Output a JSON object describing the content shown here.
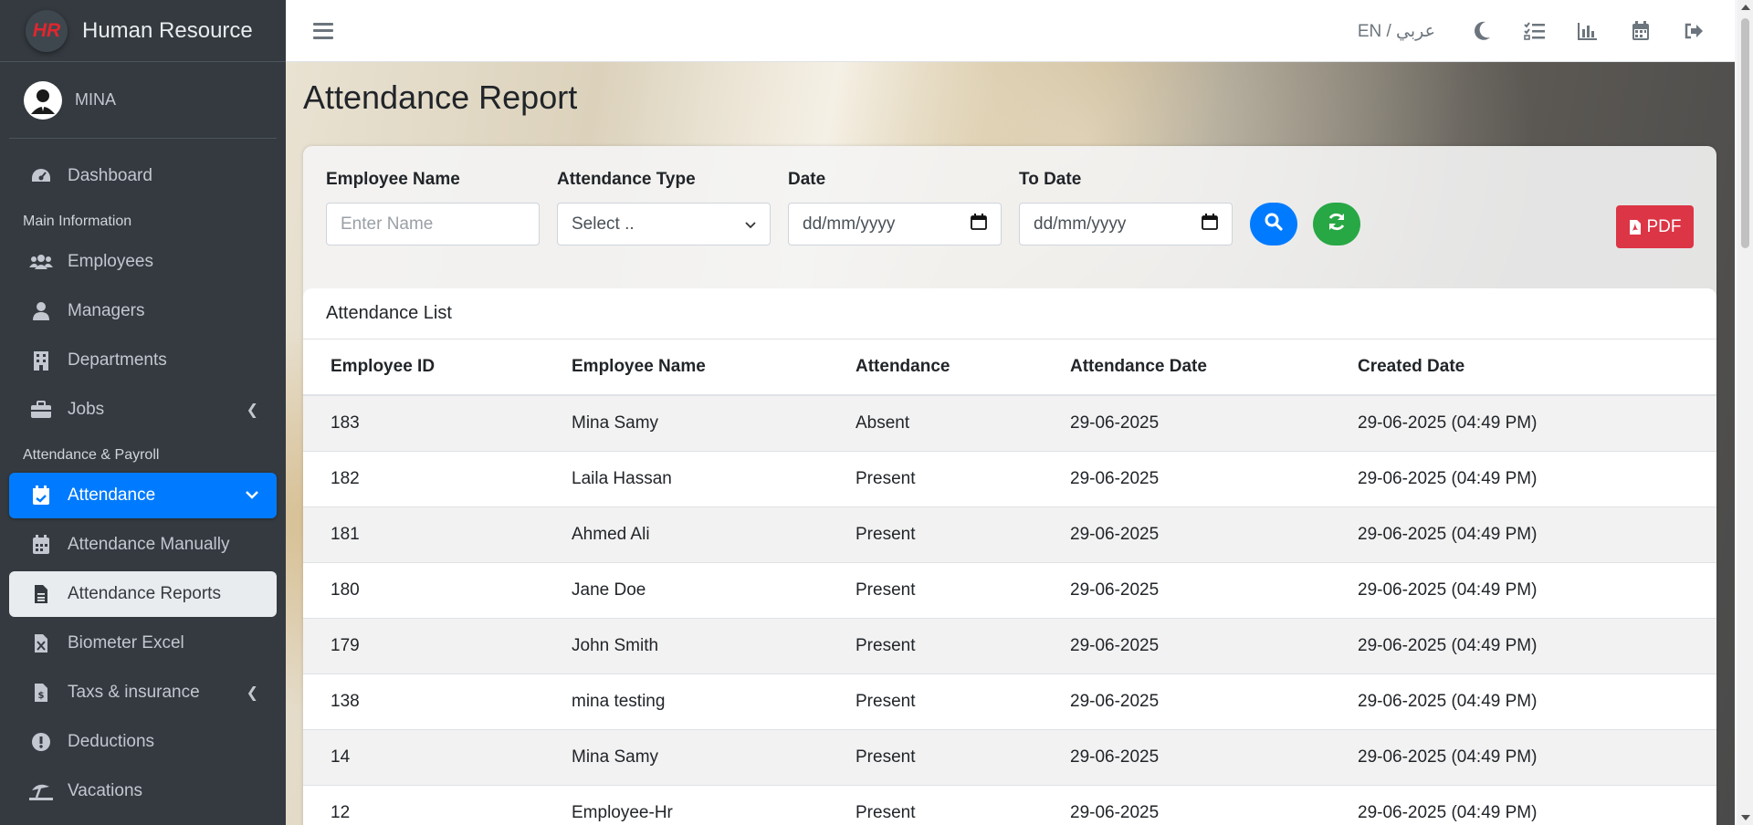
{
  "brand": {
    "name": "Human Resource",
    "logo_text": "HR"
  },
  "user": {
    "name": "MINA"
  },
  "sidebar": {
    "items": [
      {
        "label": "Dashboard",
        "icon": "tachometer-icon"
      },
      {
        "header": "Main Information"
      },
      {
        "label": "Employees",
        "icon": "users-icon"
      },
      {
        "label": "Managers",
        "icon": "user-icon"
      },
      {
        "label": "Departments",
        "icon": "building-icon"
      },
      {
        "label": "Jobs",
        "icon": "briefcase-icon"
      },
      {
        "header": "Attendance & Payroll"
      },
      {
        "label": "Attendance",
        "icon": "calendar-check-icon"
      },
      {
        "label": "Attendance Manually",
        "icon": "calendar-icon"
      },
      {
        "label": "Attendance Reports",
        "icon": "file-alt-icon"
      },
      {
        "label": "Biometer Excel",
        "icon": "file-excel-icon"
      },
      {
        "label": "Taxs & insurance",
        "icon": "file-invoice-dollar-icon"
      },
      {
        "label": "Deductions",
        "icon": "exclamation-circle-icon"
      },
      {
        "label": "Vacations",
        "icon": "umbrella-beach-icon"
      }
    ]
  },
  "topbar": {
    "language": "EN / عربي"
  },
  "page": {
    "title": "Attendance Report"
  },
  "filters": {
    "employee_name_label": "Employee Name",
    "employee_name_placeholder": "Enter Name",
    "attendance_type_label": "Attendance Type",
    "attendance_type_value": "Select ..",
    "date_label": "Date",
    "date_value": "dd/mm/yyyy",
    "to_date_label": "To Date",
    "to_date_value": "dd/mm/yyyy",
    "pdf_label": "PDF"
  },
  "list": {
    "title": "Attendance List",
    "columns": [
      "Employee ID",
      "Employee Name",
      "Attendance",
      "Attendance Date",
      "Created Date"
    ],
    "rows": [
      [
        "183",
        "Mina Samy",
        "Absent",
        "29-06-2025",
        "29-06-2025 (04:49 PM)"
      ],
      [
        "182",
        "Laila Hassan",
        "Present",
        "29-06-2025",
        "29-06-2025 (04:49 PM)"
      ],
      [
        "181",
        "Ahmed Ali",
        "Present",
        "29-06-2025",
        "29-06-2025 (04:49 PM)"
      ],
      [
        "180",
        "Jane Doe",
        "Present",
        "29-06-2025",
        "29-06-2025 (04:49 PM)"
      ],
      [
        "179",
        "John Smith",
        "Present",
        "29-06-2025",
        "29-06-2025 (04:49 PM)"
      ],
      [
        "138",
        "mina testing",
        "Present",
        "29-06-2025",
        "29-06-2025 (04:49 PM)"
      ],
      [
        "14",
        "Mina Samy",
        "Present",
        "29-06-2025",
        "29-06-2025 (04:49 PM)"
      ],
      [
        "12",
        "Employee-Hr",
        "Present",
        "29-06-2025",
        "29-06-2025 (04:49 PM)"
      ]
    ]
  },
  "colors": {
    "primary": "#007bff",
    "success": "#28a745",
    "danger": "#dc3545",
    "sidebar": "#343a40"
  }
}
